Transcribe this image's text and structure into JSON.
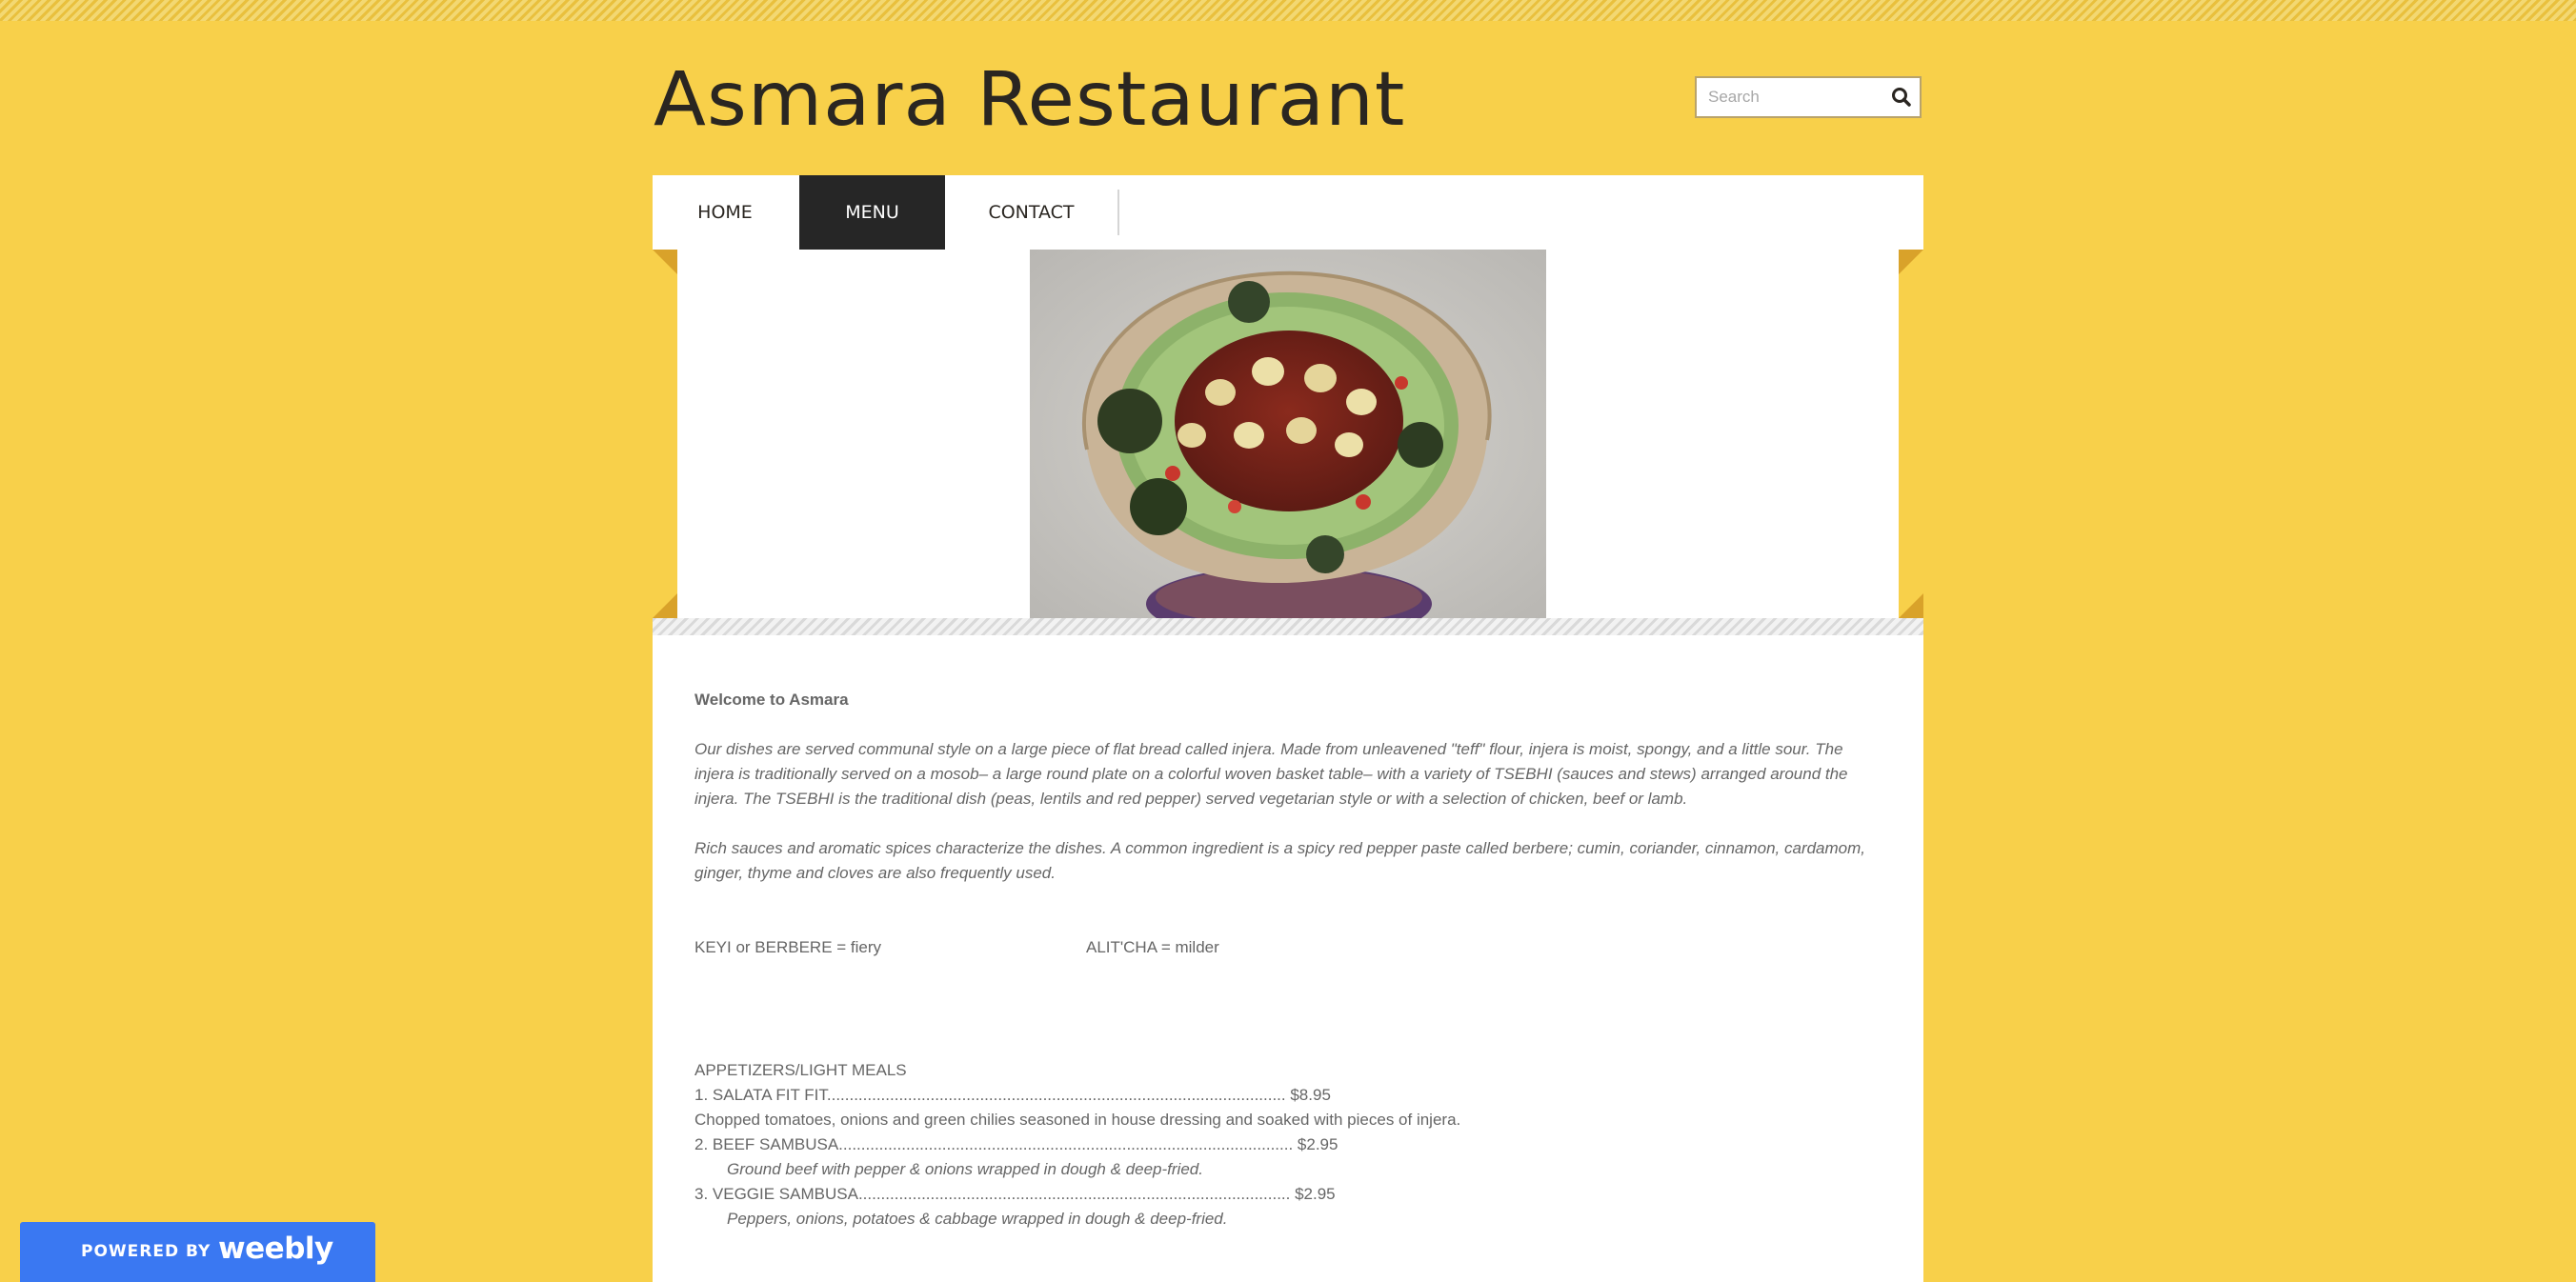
{
  "site": {
    "title": "Asmara Restaurant"
  },
  "search": {
    "placeholder": "Search",
    "icon": "search-icon"
  },
  "nav": {
    "items": [
      {
        "label": "HOME",
        "active": false
      },
      {
        "label": "MENU",
        "active": true
      },
      {
        "label": "CONTACT",
        "active": false
      }
    ]
  },
  "banner": {
    "image": "injera-platter-photo"
  },
  "content": {
    "welcome": "Welcome to Asmara",
    "intro1": "Our dishes are served communal style on a large piece of flat bread called injera.  Made from unleavened \"teff\" flour, injera is moist, spongy, and a little sour. The injera is traditionally served on a mosob– a large round plate on a colorful woven basket table– with a variety of TSEBHI (sauces and stews) arranged around the injera. The TSEBHI is the traditional dish (peas, lentils and red pepper) served vegetarian style or with a selection of chicken, beef or lamb.",
    "intro2": "Rich sauces and aromatic spices characterize the dishes.  A common ingredient is a spicy red pepper paste called berbere; cumin, coriander, cinnamon, cardamom, ginger, thyme and cloves are also frequently used.",
    "key_fiery": "KEYI or BERBERE = fiery",
    "key_milder": "ALIT'CHA  = milder",
    "section": "APPETIZERS/LIGHT MEALS",
    "items": [
      {
        "line": "1. SALATA FIT FIT...................................................................................................... $8.95",
        "desc": "Chopped tomatoes, onions and green chilies seasoned in house dressing and soaked with pieces of injera."
      },
      {
        "line": "2. BEEF SAMBUSA..................................................................................................... $2.95",
        "desc": "Ground beef with pepper & onions wrapped in dough & deep-fried."
      },
      {
        "line": "3. VEGGIE SAMBUSA................................................................................................ $2.95",
        "desc": "Peppers, onions, potatoes & cabbage wrapped in dough & deep-fried."
      }
    ]
  },
  "footer_badge": {
    "powered": "POWERED BY",
    "brand": "weebly"
  },
  "colors": {
    "background": "#f8d04a",
    "nav_active": "#262626",
    "badge": "#3a78f2",
    "fold": "#d9a22a"
  }
}
